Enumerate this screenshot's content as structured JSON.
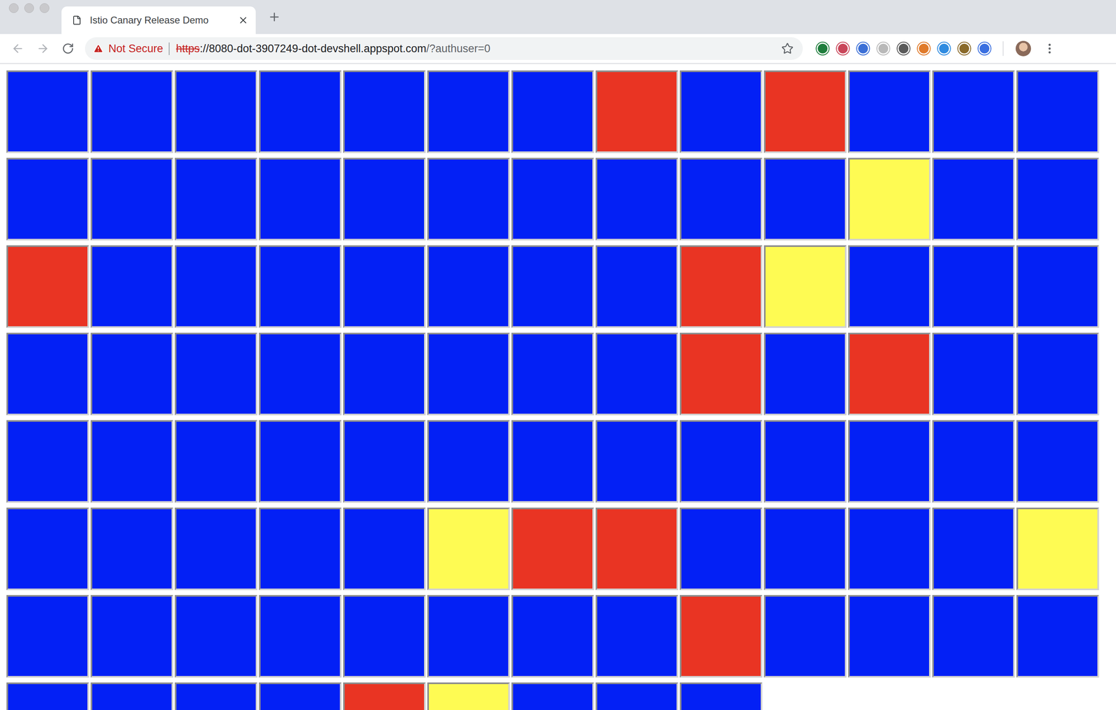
{
  "tabs": [
    {
      "label": "Istio Canary Release Demo",
      "selected": true
    }
  ],
  "address_bar": {
    "security": "Not Secure",
    "scheme": "https",
    "host": "://8080-dot-3907249-dot-devshell.appspot.com",
    "path": "/?authuser=0"
  },
  "extensions": [
    {
      "color": "#1e7d3c"
    },
    {
      "color": "#c9465a"
    },
    {
      "color": "#3b6fd6"
    },
    {
      "color": "#b9b9b9"
    },
    {
      "color": "#5a5a5a"
    },
    {
      "color": "#e07a2a"
    },
    {
      "color": "#2f8be0"
    },
    {
      "color": "#8a6a2a"
    },
    {
      "color": "#3a6fe0"
    }
  ],
  "cells": [
    {
      "color": "#0320f5"
    },
    {
      "color": "#0320f5"
    },
    {
      "color": "#0320f5"
    },
    {
      "color": "#0320f5"
    },
    {
      "color": "#0320f5"
    },
    {
      "color": "#0320f5"
    },
    {
      "color": "#0320f5"
    },
    {
      "color": "#e93423"
    },
    {
      "color": "#0320f5"
    },
    {
      "color": "#e93423"
    },
    {
      "color": "#0320f5"
    },
    {
      "color": "#0320f5"
    },
    {
      "color": "#0320f5"
    },
    {
      "color": "#0320f5"
    },
    {
      "color": "#0320f5"
    },
    {
      "color": "#0320f5"
    },
    {
      "color": "#0320f5"
    },
    {
      "color": "#0320f5"
    },
    {
      "color": "#0320f5"
    },
    {
      "color": "#0320f5"
    },
    {
      "color": "#0320f5"
    },
    {
      "color": "#0320f5"
    },
    {
      "color": "#0320f5"
    },
    {
      "color": "#fefb53"
    },
    {
      "color": "#0320f5"
    },
    {
      "color": "#0320f5"
    },
    {
      "color": "#e93423"
    },
    {
      "color": "#0320f5"
    },
    {
      "color": "#0320f5"
    },
    {
      "color": "#0320f5"
    },
    {
      "color": "#0320f5"
    },
    {
      "color": "#0320f5"
    },
    {
      "color": "#0320f5"
    },
    {
      "color": "#0320f5"
    },
    {
      "color": "#e93423"
    },
    {
      "color": "#fefb53"
    },
    {
      "color": "#0320f5"
    },
    {
      "color": "#0320f5"
    },
    {
      "color": "#0320f5"
    },
    {
      "color": "#0320f5"
    },
    {
      "color": "#0320f5"
    },
    {
      "color": "#0320f5"
    },
    {
      "color": "#0320f5"
    },
    {
      "color": "#0320f5"
    },
    {
      "color": "#0320f5"
    },
    {
      "color": "#0320f5"
    },
    {
      "color": "#0320f5"
    },
    {
      "color": "#e93423"
    },
    {
      "color": "#0320f5"
    },
    {
      "color": "#e93423"
    },
    {
      "color": "#0320f5"
    },
    {
      "color": "#0320f5"
    },
    {
      "color": "#0320f5"
    },
    {
      "color": "#0320f5"
    },
    {
      "color": "#0320f5"
    },
    {
      "color": "#0320f5"
    },
    {
      "color": "#0320f5"
    },
    {
      "color": "#0320f5"
    },
    {
      "color": "#0320f5"
    },
    {
      "color": "#0320f5"
    },
    {
      "color": "#0320f5"
    },
    {
      "color": "#0320f5"
    },
    {
      "color": "#0320f5"
    },
    {
      "color": "#0320f5"
    },
    {
      "color": "#0320f5"
    },
    {
      "color": "#0320f5"
    },
    {
      "color": "#0320f5"
    },
    {
      "color": "#0320f5"
    },
    {
      "color": "#0320f5"
    },
    {
      "color": "#0320f5"
    },
    {
      "color": "#fefb53"
    },
    {
      "color": "#e93423"
    },
    {
      "color": "#e93423"
    },
    {
      "color": "#0320f5"
    },
    {
      "color": "#0320f5"
    },
    {
      "color": "#0320f5"
    },
    {
      "color": "#0320f5"
    },
    {
      "color": "#fefb53"
    },
    {
      "color": "#0320f5"
    },
    {
      "color": "#0320f5"
    },
    {
      "color": "#0320f5"
    },
    {
      "color": "#0320f5"
    },
    {
      "color": "#0320f5"
    },
    {
      "color": "#0320f5"
    },
    {
      "color": "#0320f5"
    },
    {
      "color": "#0320f5"
    },
    {
      "color": "#e93423"
    },
    {
      "color": "#0320f5"
    },
    {
      "color": "#0320f5"
    },
    {
      "color": "#0320f5"
    },
    {
      "color": "#0320f5"
    },
    {
      "color": "#0320f5"
    },
    {
      "color": "#0320f5"
    },
    {
      "color": "#0320f5"
    },
    {
      "color": "#0320f5"
    },
    {
      "color": "#e93423"
    },
    {
      "color": "#fefb53"
    },
    {
      "color": "#0320f5"
    },
    {
      "color": "#0320f5"
    },
    {
      "color": "#0320f5"
    }
  ]
}
